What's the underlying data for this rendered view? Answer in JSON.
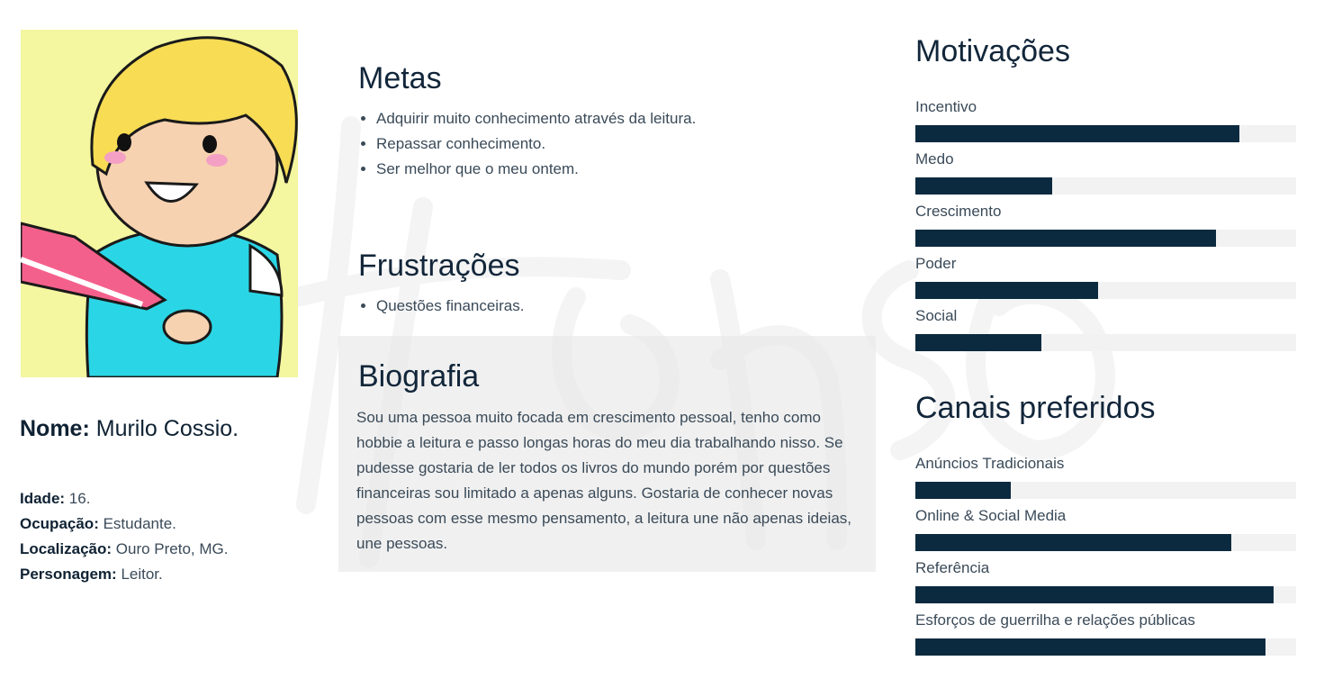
{
  "profile": {
    "name_label": "Nome:",
    "name_value": "Murilo Cossio.",
    "age_label": "Idade:",
    "age_value": "16.",
    "occupation_label": "Ocupação:",
    "occupation_value": "Estudante.",
    "location_label": "Localização:",
    "location_value": "Ouro Preto, MG.",
    "character_label": "Personagem:",
    "character_value": "Leitor."
  },
  "metas": {
    "title": "Metas",
    "items": [
      "Adquirir muito conhecimento através da leitura.",
      "Repassar conhecimento.",
      "Ser melhor que o meu ontem."
    ]
  },
  "frustracoes": {
    "title": "Frustrações",
    "items": [
      "Questões financeiras."
    ]
  },
  "biografia": {
    "title": "Biografia",
    "text": "Sou uma pessoa muito focada em crescimento pessoal, tenho como hobbie a leitura e passo longas horas do meu dia trabalhando nisso. Se pudesse gostaria de ler todos os livros do mundo porém por questões financeiras sou limitado a apenas alguns. Gostaria de conhecer novas pessoas com esse mesmo pensamento, a leitura une não apenas ideias, une pessoas."
  },
  "motivacoes": {
    "title": "Motivações",
    "bars": [
      {
        "label": "Incentivo",
        "value": 0.85
      },
      {
        "label": "Medo",
        "value": 0.36
      },
      {
        "label": "Crescimento",
        "value": 0.79
      },
      {
        "label": "Poder",
        "value": 0.48
      },
      {
        "label": "Social",
        "value": 0.33
      }
    ]
  },
  "canais": {
    "title": "Canais preferidos",
    "bars": [
      {
        "label": "Anúncios Tradicionais",
        "value": 0.25
      },
      {
        "label": "Online & Social Media",
        "value": 0.83
      },
      {
        "label": "Referência",
        "value": 0.94
      },
      {
        "label": "Esforços de guerrilha e relações públicas",
        "value": 0.92
      }
    ]
  },
  "colors": {
    "bar_fill": "#0b2a3f",
    "bar_track": "#f2f2f2",
    "heading": "#12263a"
  }
}
